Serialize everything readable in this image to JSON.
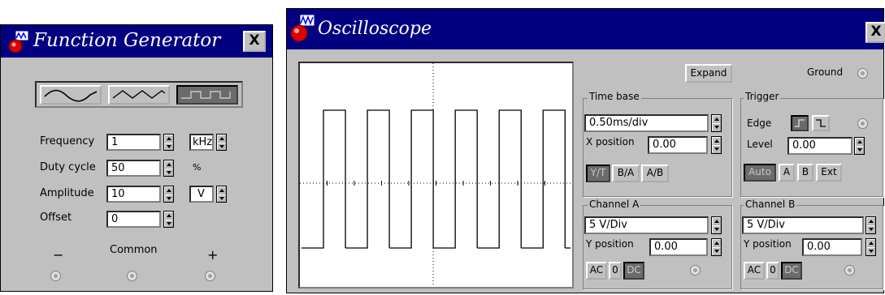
{
  "function_generator": {
    "title": "Function Generator",
    "close_glyph": "X",
    "waveforms": [
      {
        "name": "sine",
        "selected": false
      },
      {
        "name": "triangle",
        "selected": false
      },
      {
        "name": "square",
        "selected": true
      }
    ],
    "frequency": {
      "label": "Frequency",
      "value": "1",
      "unit": "kHz"
    },
    "duty_cycle": {
      "label": "Duty cycle",
      "value": "50",
      "unit": "%"
    },
    "amplitude": {
      "label": "Amplitude",
      "value": "10",
      "unit": "V"
    },
    "offset": {
      "label": "Offset",
      "value": "0"
    },
    "terminals": {
      "minus": "−",
      "common": "Common",
      "plus": "+"
    }
  },
  "oscilloscope": {
    "title": "Oscilloscope",
    "close_glyph": "X",
    "expand_label": "Expand",
    "ground_label": "Ground",
    "time_base": {
      "title": "Time base",
      "value": "0.50ms/div",
      "x_position_label": "X position",
      "x_position_value": "0.00",
      "modes": [
        {
          "label": "Y/T",
          "pressed": true
        },
        {
          "label": "B/A",
          "pressed": false
        },
        {
          "label": "A/B",
          "pressed": false
        }
      ]
    },
    "trigger": {
      "title": "Trigger",
      "edge_label": "Edge",
      "level_label": "Level",
      "level_value": "0.00",
      "sources": [
        {
          "label": "Auto",
          "pressed": true
        },
        {
          "label": "A",
          "pressed": false
        },
        {
          "label": "B",
          "pressed": false
        },
        {
          "label": "Ext",
          "pressed": false
        }
      ]
    },
    "channel_a": {
      "title": "Channel A",
      "value": "5 V/Div",
      "y_position_label": "Y position",
      "y_position_value": "0.00",
      "coupling": [
        {
          "label": "AC",
          "pressed": false
        },
        {
          "label": "0",
          "pressed": false
        },
        {
          "label": "DC",
          "pressed": true
        }
      ]
    },
    "channel_b": {
      "title": "Channel B",
      "value": "5 V/Div",
      "y_position_label": "Y position",
      "y_position_value": "0.00",
      "coupling": [
        {
          "label": "AC",
          "pressed": false
        },
        {
          "label": "0",
          "pressed": false
        },
        {
          "label": "DC",
          "pressed": true
        }
      ]
    },
    "trace": {
      "color": "#000000",
      "pulses_visible": 6,
      "duty_cycle_percent": 50
    }
  }
}
